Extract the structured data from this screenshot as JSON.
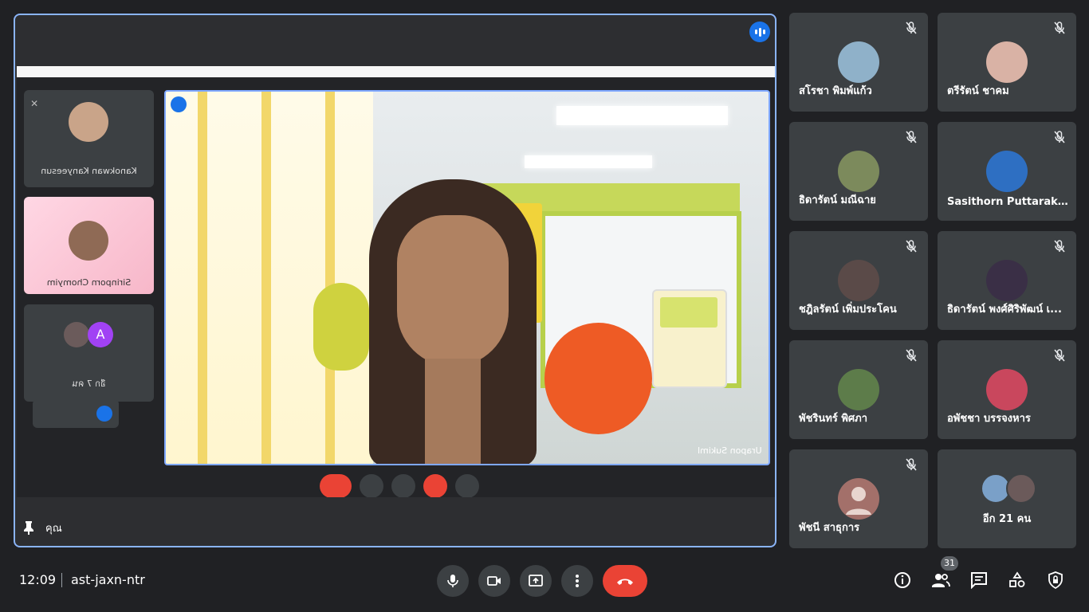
{
  "meeting": {
    "time": "12:09",
    "code": "ast-jaxn-ntr"
  },
  "main_tile": {
    "self_label": "คุณ",
    "shared_screen": {
      "speaker_name_mirrored": "Urapon Sukiml",
      "mini_tiles": [
        {
          "name": "Kanokwan Kanyeesun"
        },
        {
          "name": "Sirinporn Chomyim"
        },
        {
          "name": "อีก 7 คน"
        }
      ]
    }
  },
  "participants": [
    {
      "name": "สโรชา พิมพ์แก้ว",
      "muted": true,
      "avatar_color": "#8fb1c9"
    },
    {
      "name": "ตรีรัตน์ ชาคม",
      "muted": true,
      "avatar_color": "#d9b2a5"
    },
    {
      "name": "ธิดารัตน์ มณีฉาย",
      "muted": true,
      "avatar_color": "#7c8a5c"
    },
    {
      "name": "Sasithorn Puttaraksa",
      "muted": true,
      "avatar_color": "#2e6fc2"
    },
    {
      "name": "ชฎิลรัตน์ เพิ่มประโคน",
      "muted": true,
      "avatar_color": "#5a4a48"
    },
    {
      "name": "ธิดารัตน์ พงศ์ศิริพัฒน์ เ...",
      "muted": true,
      "avatar_color": "#3a2f46"
    },
    {
      "name": "พัชรินทร์ พิศภา",
      "muted": true,
      "avatar_color": "#5d7c4a"
    },
    {
      "name": "อพัชชา บรรจงหาร",
      "muted": true,
      "avatar_color": "#c9475d"
    },
    {
      "name": "พัชนี สาธุการ",
      "muted": true,
      "avatar_color": "#a3706a"
    }
  ],
  "more_tile": {
    "label": "อีก 21 คน"
  },
  "people_count": "31",
  "colors": {
    "background": "#202124",
    "tile": "#3c4043",
    "accent": "#8ab4f8",
    "end_call": "#ea4335",
    "speaking": "#1a73e8"
  },
  "icons": {
    "controls": [
      "mic-icon",
      "camera-icon",
      "present-icon",
      "more-options-icon",
      "end-call-icon"
    ],
    "right": [
      "info-icon",
      "people-icon",
      "chat-icon",
      "activities-icon",
      "host-controls-icon"
    ]
  }
}
